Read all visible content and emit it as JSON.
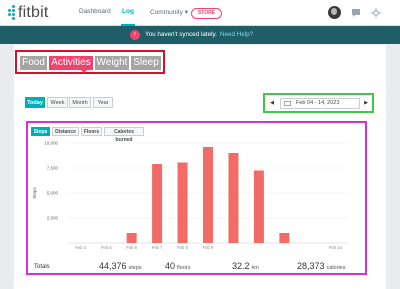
{
  "brand": {
    "name": "fitbit",
    "accent": "#00b0b9",
    "alert": "#f0436e"
  },
  "nav": {
    "items": [
      {
        "label": "Dashboard",
        "active": false
      },
      {
        "label": "Log",
        "active": true
      },
      {
        "label": "Community",
        "active": false
      }
    ],
    "community_caret": "▾",
    "store_label": "STORE",
    "icons": [
      "avatar",
      "chat-icon",
      "gear-icon"
    ]
  },
  "sync": {
    "badge": "!",
    "message": "You haven't synced lately.",
    "help_link": "Need Help?"
  },
  "categories": {
    "tabs": [
      "Food",
      "Activities",
      "Weight",
      "Sleep"
    ],
    "selected": "Activities"
  },
  "period": {
    "buttons": [
      "Today",
      "Week",
      "Month",
      "Year"
    ],
    "selected": "Today"
  },
  "date_range": {
    "prev": "◀",
    "label": "Feb 04 - 14, 2023",
    "next": "▶"
  },
  "metrics": {
    "tabs": [
      "Steps",
      "Distance",
      "Floors",
      "Calories burned"
    ],
    "selected": "Steps"
  },
  "chart_data": {
    "type": "bar",
    "ylabel": "Steps",
    "ylim": [
      0,
      10000
    ],
    "yticks": [
      "10,000",
      "7,500",
      "5,000",
      "2,500"
    ],
    "ytick_values": [
      10000,
      7500,
      5000,
      2500
    ],
    "categories": [
      "Feb 4",
      "Feb 5",
      "Feb 6",
      "Feb 7",
      "Feb 8",
      "Feb 9",
      "Feb 10",
      "Feb 11",
      "Feb 12",
      "Feb 13",
      "Feb 14"
    ],
    "xtick_labels": [
      "Feb 4",
      "Feb 5",
      "Feb 6",
      "Feb 7",
      "Feb 8",
      "Feb 9",
      "",
      "",
      "",
      "",
      "Feb 14"
    ],
    "values": [
      0,
      0,
      1000,
      7900,
      8050,
      9600,
      9000,
      7250,
      1000,
      0,
      0
    ],
    "bar_color": "#f36b66"
  },
  "totals": {
    "label": "Totals",
    "items": [
      {
        "value": "44,376",
        "unit": "steps"
      },
      {
        "value": "40",
        "unit": "floors"
      },
      {
        "value": "32.2",
        "unit": "km"
      },
      {
        "value": "28,373",
        "unit": "calories"
      }
    ]
  }
}
